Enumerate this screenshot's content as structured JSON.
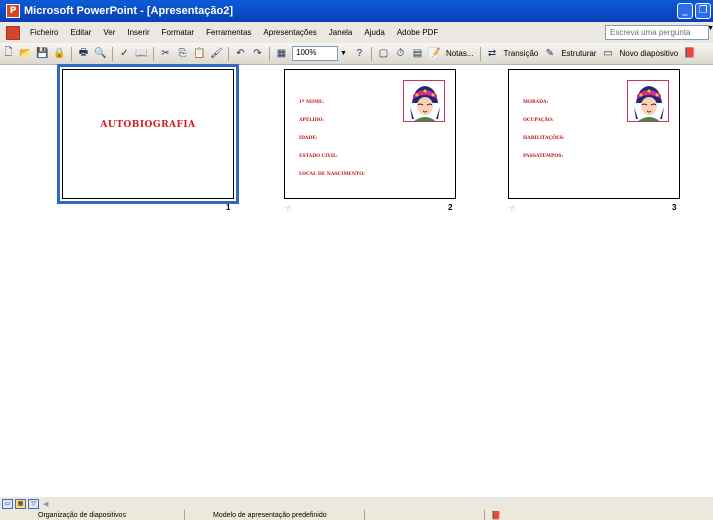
{
  "window": {
    "title": "Microsoft PowerPoint - [Apresentação2]",
    "controls": [
      "_",
      "❐"
    ]
  },
  "menubar": {
    "items": [
      "Ficheiro",
      "Editar",
      "Ver",
      "Inserir",
      "Formatar",
      "Ferramentas",
      "Apresentações",
      "Janela",
      "Ajuda",
      "Adobe PDF"
    ],
    "ask_placeholder": "Escreva uma pergunta"
  },
  "toolbar": {
    "zoom": "100%",
    "notes_label": "Notas...",
    "transition_label": "Transição",
    "design_label": "Estruturar",
    "new_slide_label": "Novo diapositivo"
  },
  "slides": [
    {
      "number": "1",
      "title": "AUTOBIOGRAFIA",
      "fields": []
    },
    {
      "number": "2",
      "title": "",
      "fields": [
        "1º NOME:",
        "APELIDO:",
        "IDADE:",
        "ESTADO CIVIL:",
        "LOCAL DE NASCIMENTO:"
      ]
    },
    {
      "number": "3",
      "title": "",
      "fields": [
        "MORADA:",
        "OCUPAÇÃO:",
        "HABILITAÇÕES:",
        "PASSATEMPOS:"
      ]
    }
  ],
  "statusbar": {
    "view": "Organização de diapositivos",
    "template": "Modelo de apresentação predefinido"
  },
  "colors": {
    "title_bar": "#0b5bd6",
    "slide_text": "#c41616",
    "selection": "#316ac5"
  }
}
